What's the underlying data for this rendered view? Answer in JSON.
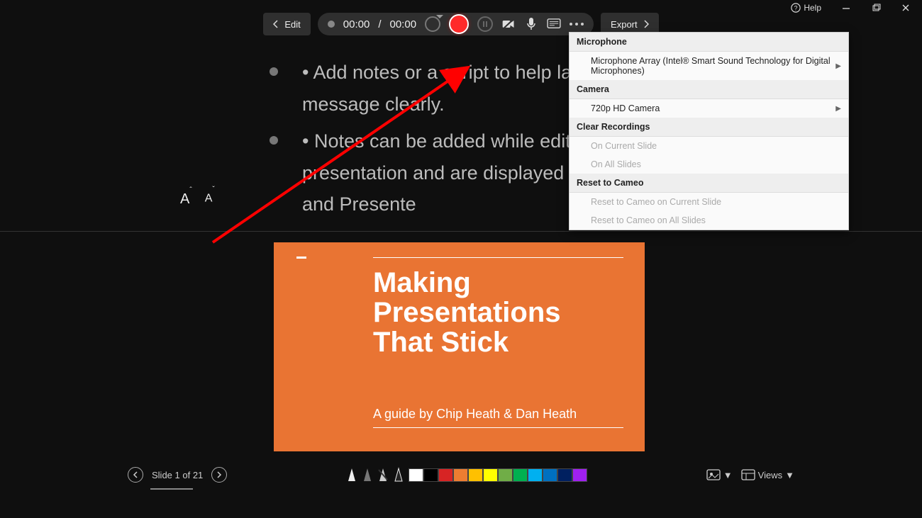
{
  "titlebar": {
    "help_label": "Help"
  },
  "toolbar": {
    "edit_label": "Edit",
    "record": {
      "elapsed": "00:00",
      "sep": "/",
      "total": "00:00"
    },
    "export_label": "Export"
  },
  "teleprompter": {
    "bullets": [
      "• Add notes or a script to help land your message clearly.",
      "• Notes can be added while editing your presentation and are displayed in Teleprompter and Presente"
    ]
  },
  "slide": {
    "title": "Making Presentations That Stick",
    "subtitle": "A guide by Chip Heath & Dan Heath"
  },
  "menu": {
    "sections": {
      "microphone": {
        "header": "Microphone",
        "item": "Microphone Array (Intel® Smart Sound Technology for Digital Microphones)"
      },
      "camera": {
        "header": "Camera",
        "item": "720p HD Camera"
      },
      "clear": {
        "header": "Clear Recordings",
        "item1": "On Current Slide",
        "item2": "On All Slides"
      },
      "reset": {
        "header": "Reset to Cameo",
        "item1": "Reset to Cameo on Current Slide",
        "item2": "Reset to Cameo on All Slides"
      }
    }
  },
  "bottombar": {
    "slide_counter": "Slide 1 of 21",
    "views_label": "Views",
    "colors": [
      "#ffffff",
      "#000000",
      "#d72424",
      "#ed7d31",
      "#ffc000",
      "#ffff00",
      "#70ad47",
      "#00b050",
      "#00b0f0",
      "#0070c0",
      "#002060",
      "#a020f0"
    ]
  }
}
